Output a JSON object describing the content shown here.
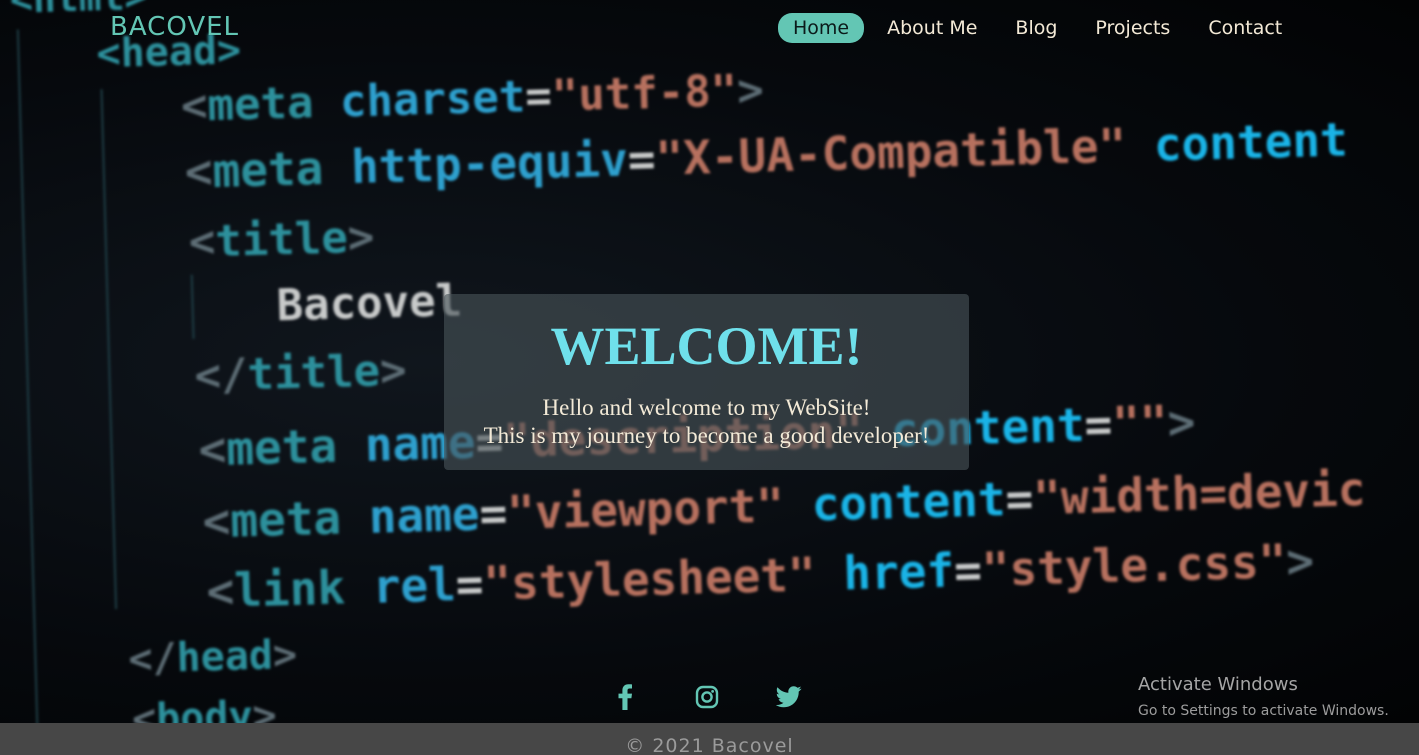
{
  "header": {
    "logo": "BACOVEL",
    "nav": [
      {
        "label": "Home",
        "active": true
      },
      {
        "label": "About Me",
        "active": false
      },
      {
        "label": "Blog",
        "active": false
      },
      {
        "label": "Projects",
        "active": false
      },
      {
        "label": "Contact",
        "active": false
      }
    ]
  },
  "background_code": [
    "<html>",
    "<head>",
    "<meta charset=\"utf-8\">",
    "<meta http-equiv=\"X-UA-Compatible\" content",
    "<title>",
    "Bacovel",
    "</title>",
    "<meta name=\"description\" content=\"\">",
    "<meta name=\"viewport\" content=\"width=devic",
    "<link rel=\"stylesheet\" href=\"style.css\">",
    "</head>",
    "<body>"
  ],
  "welcome": {
    "title": "WELCOME!",
    "line1": "Hello and welcome to my WebSite!",
    "line2": "This is my journey to become a good developer!"
  },
  "social": {
    "icons": [
      "facebook-icon",
      "instagram-icon",
      "twitter-icon"
    ],
    "color": "#63c6b4"
  },
  "watermark": {
    "line1": "Activate Windows",
    "line2": "Go to Settings to activate Windows."
  },
  "footer": {
    "text": "© 2021 Bacovel"
  },
  "colors": {
    "accent": "#63c6b4",
    "welcome_title": "#6fe0eb",
    "text": "#f3ead7",
    "footer_bg": "#474747"
  }
}
